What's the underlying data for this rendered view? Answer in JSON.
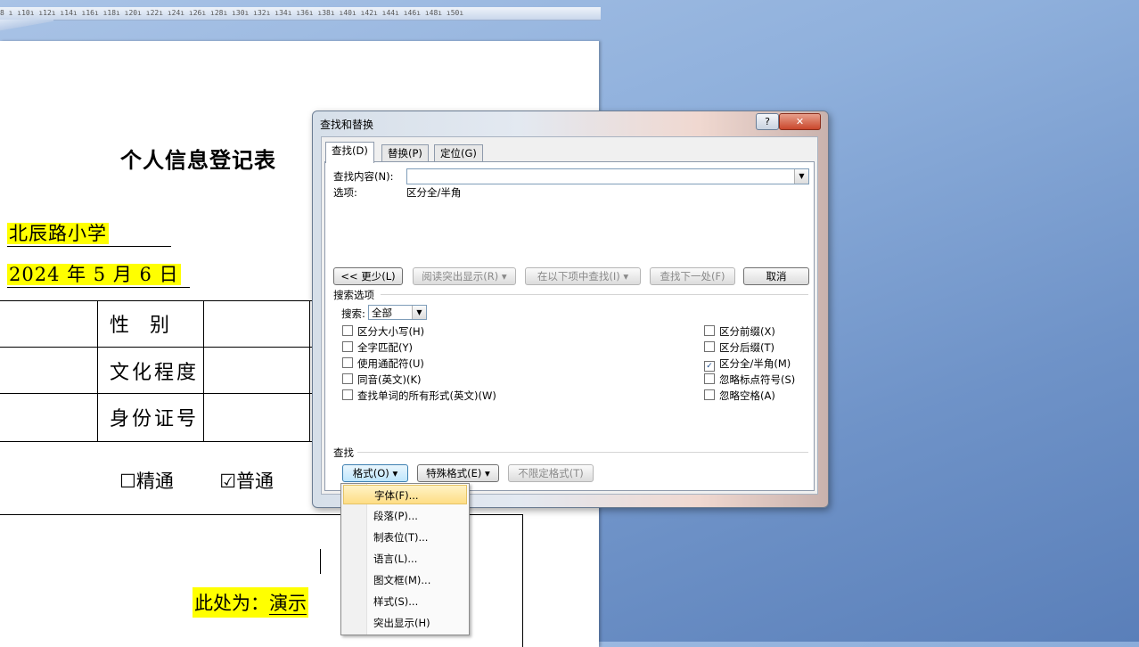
{
  "ruler": {
    "text": "8 ı ı10ı ı12ı ı14ı ı16ı ı18ı ı20ı ı22ı ı24ı ı26ı ı28ı ı30ı ı32ı ı34ı ı36ı ı38ı ı40ı ı42ı ı44ı ı46ı ı48ı ı50ı"
  },
  "document": {
    "title": "个人信息登记表",
    "school": "北辰路小学",
    "date": "2024 年 5 月 6 日",
    "table": {
      "gender_label": "性  别",
      "education_label": "文化程度",
      "id_label": "身份证号"
    },
    "level_options": [
      {
        "box": "☐",
        "label": "精通"
      },
      {
        "box": "☑",
        "label": "普通"
      }
    ],
    "demo_prefix": "此处为：",
    "demo_text": "演示"
  },
  "dialog": {
    "title": "查找和替换",
    "help_label": "?",
    "close_label": "✕",
    "tabs": [
      {
        "label": "查找(D)",
        "active": true
      },
      {
        "label": "替换(P)",
        "active": false
      },
      {
        "label": "定位(G)",
        "active": false
      }
    ],
    "find_label": "查找内容(N):",
    "find_value": "",
    "options_label": "选项:",
    "options_value": "区分全/半角",
    "buttons": {
      "less": "<< 更少(L)",
      "reading_highlight": "阅读突出显示(R) ▾",
      "find_in": "在以下项中查找(I) ▾",
      "find_next": "查找下一处(F)",
      "cancel": "取消"
    },
    "search_options_title": "搜索选项",
    "search_label": "搜索:",
    "search_value": "全部",
    "left_checks": [
      {
        "label": "区分大小写(H)",
        "checked": false
      },
      {
        "label": "全字匹配(Y)",
        "checked": false
      },
      {
        "label": "使用通配符(U)",
        "checked": false
      },
      {
        "label": "同音(英文)(K)",
        "checked": false
      },
      {
        "label": "查找单词的所有形式(英文)(W)",
        "checked": false
      }
    ],
    "right_checks": [
      {
        "label": "区分前缀(X)",
        "checked": false
      },
      {
        "label": "区分后缀(T)",
        "checked": false
      },
      {
        "label": "区分全/半角(M)",
        "checked": true
      },
      {
        "label": "忽略标点符号(S)",
        "checked": false
      },
      {
        "label": "忽略空格(A)",
        "checked": false
      }
    ],
    "find_group_title": "查找",
    "format_button": "格式(O) ▾",
    "special_button": "特殊格式(E) ▾",
    "no_format_button": "不限定格式(T)"
  },
  "format_menu": {
    "items": [
      {
        "label": "字体(F)...",
        "active": true
      },
      {
        "label": "段落(P)...",
        "active": false
      },
      {
        "label": "制表位(T)...",
        "active": false
      },
      {
        "label": "语言(L)...",
        "active": false
      },
      {
        "label": "图文框(M)...",
        "active": false
      },
      {
        "label": "样式(S)...",
        "active": false
      },
      {
        "label": "突出显示(H)",
        "active": false
      }
    ]
  }
}
